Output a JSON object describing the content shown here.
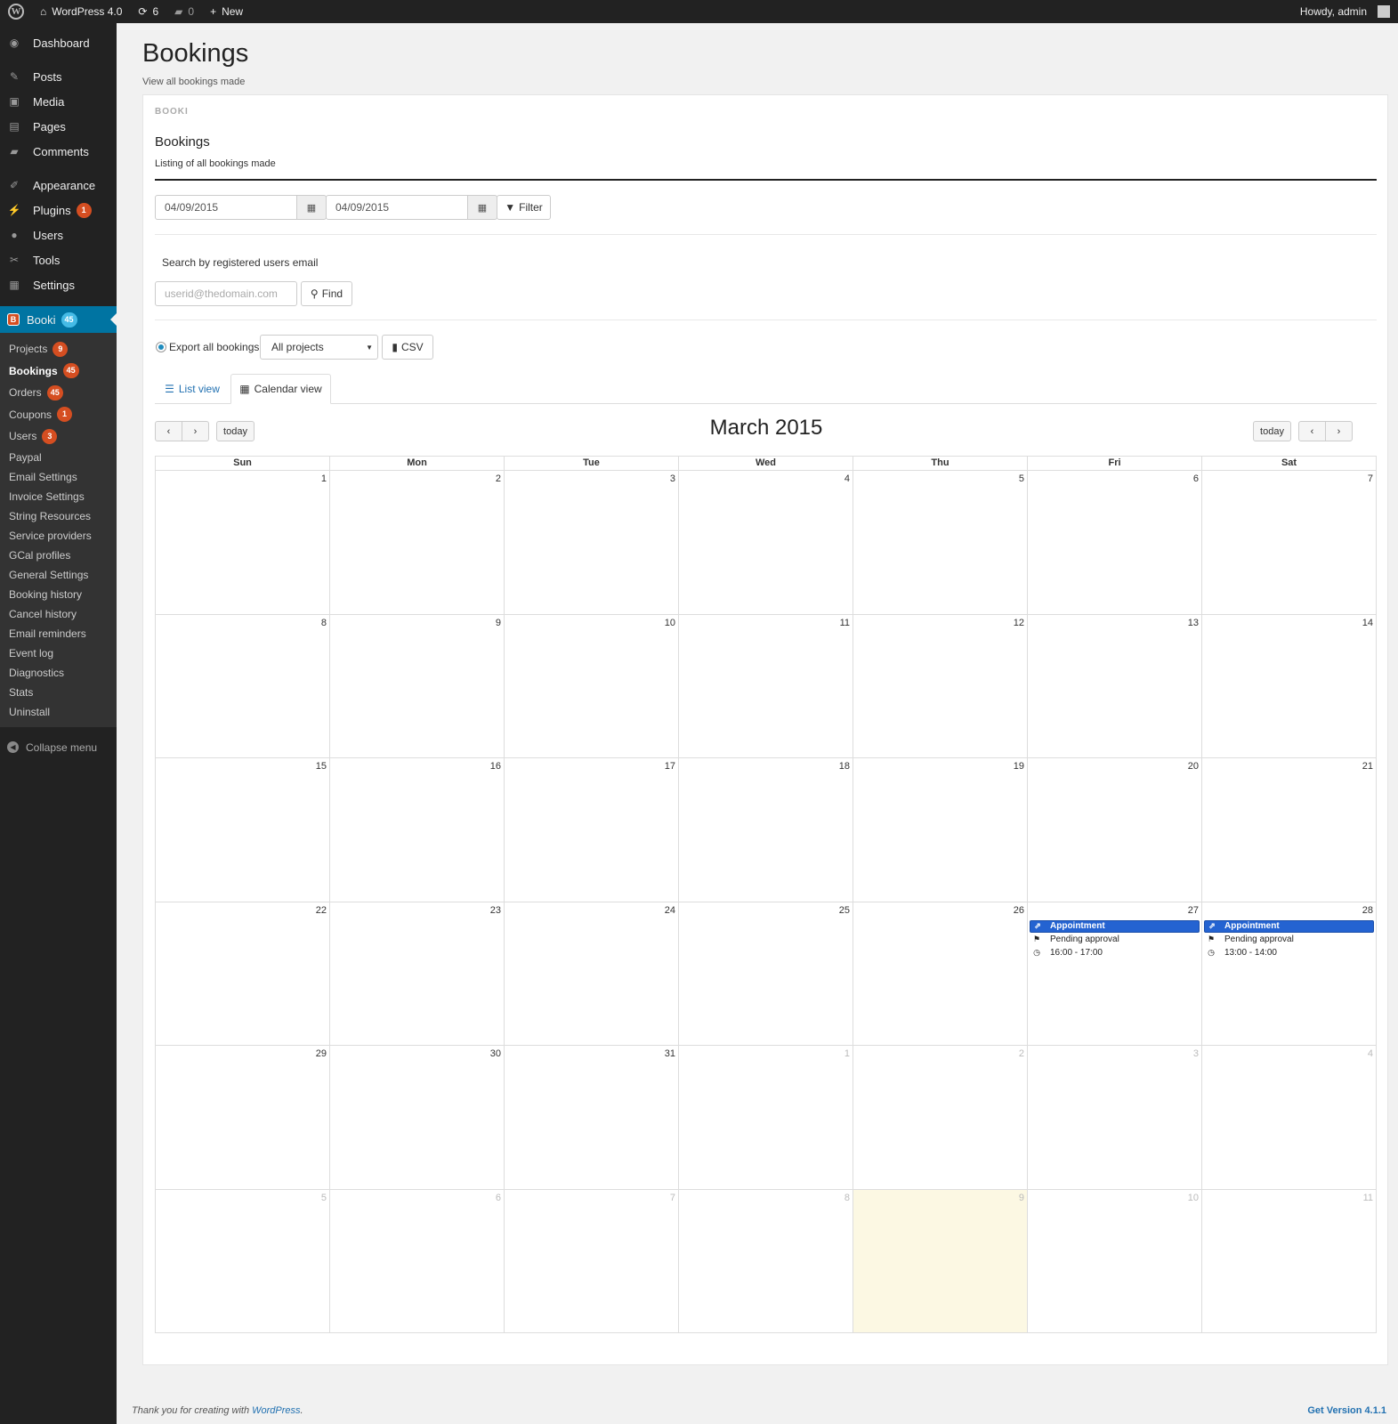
{
  "adminbar": {
    "site_name": "WordPress 4.0",
    "updates_count": "6",
    "comments_count": "0",
    "new_label": "New",
    "howdy": "Howdy, admin"
  },
  "sidebar": {
    "items": [
      {
        "label": "Dashboard",
        "icon": "dashboard-icon"
      },
      {
        "label": "Posts",
        "icon": "pin-icon"
      },
      {
        "label": "Media",
        "icon": "media-icon"
      },
      {
        "label": "Pages",
        "icon": "pages-icon"
      },
      {
        "label": "Comments",
        "icon": "comment-icon"
      },
      {
        "label": "Appearance",
        "icon": "brush-icon"
      },
      {
        "label": "Plugins",
        "icon": "plug-icon",
        "badge": "1"
      },
      {
        "label": "Users",
        "icon": "user-icon"
      },
      {
        "label": "Tools",
        "icon": "wrench-icon"
      },
      {
        "label": "Settings",
        "icon": "settings-icon"
      }
    ],
    "booki": {
      "label": "Booki",
      "badge": "45"
    },
    "submenu": [
      {
        "label": "Projects",
        "badge": "9"
      },
      {
        "label": "Bookings",
        "badge": "45"
      },
      {
        "label": "Orders",
        "badge": "45"
      },
      {
        "label": "Coupons",
        "badge": "1"
      },
      {
        "label": "Users",
        "badge": "3"
      },
      {
        "label": "Paypal"
      },
      {
        "label": "Email Settings"
      },
      {
        "label": "Invoice Settings"
      },
      {
        "label": "String Resources"
      },
      {
        "label": "Service providers"
      },
      {
        "label": "GCal profiles"
      },
      {
        "label": "General Settings"
      },
      {
        "label": "Booking history"
      },
      {
        "label": "Cancel history"
      },
      {
        "label": "Email reminders"
      },
      {
        "label": "Event log"
      },
      {
        "label": "Diagnostics"
      },
      {
        "label": "Stats"
      },
      {
        "label": "Uninstall"
      }
    ],
    "collapse_label": "Collapse menu"
  },
  "page": {
    "title": "Bookings",
    "subtitle": "View all bookings made",
    "panel_label": "BOOKI",
    "section_title": "Bookings",
    "section_sub": "Listing of all bookings made"
  },
  "filters": {
    "date_from": "04/09/2015",
    "date_to": "04/09/2015",
    "filter_label": "Filter",
    "search_label": "Search by registered users email",
    "email_placeholder": "userid@thedomain.com",
    "find_label": "Find",
    "export_label": "Export all bookings",
    "project_select": "All projects",
    "csv_label": "CSV"
  },
  "tabs": {
    "list_view": "List view",
    "calendar_view": "Calendar view"
  },
  "calendar": {
    "title": "March 2015",
    "today_label": "today",
    "prev_label": "‹",
    "next_label": "›",
    "weekdays": [
      "Sun",
      "Mon",
      "Tue",
      "Wed",
      "Thu",
      "Fri",
      "Sat"
    ],
    "days": [
      "1",
      "2",
      "3",
      "4",
      "5",
      "6",
      "7",
      "8",
      "9",
      "10",
      "11",
      "12",
      "13",
      "14",
      "15",
      "16",
      "17",
      "18",
      "19",
      "20",
      "21",
      "22",
      "23",
      "24",
      "25",
      "26",
      "27",
      "28",
      "29",
      "30",
      "31",
      "1",
      "2",
      "3",
      "4",
      "5",
      "6",
      "7",
      "8",
      "9",
      "10",
      "11"
    ],
    "other_month_from": 31,
    "today_index": 39,
    "events": [
      {
        "day_index": 26,
        "title": "Appointment",
        "status": "Pending approval",
        "time": "16:00 - 17:00"
      },
      {
        "day_index": 27,
        "title": "Appointment",
        "status": "Pending approval",
        "time": "13:00 - 14:00"
      }
    ],
    "event_color": "#2463d1",
    "today_color": "#fcf8e3"
  },
  "footer": {
    "thanks_prefix": "Thank you for creating with ",
    "thanks_link": "WordPress",
    "thanks_suffix": ".",
    "version_link": "Get Version 4.1.1"
  }
}
